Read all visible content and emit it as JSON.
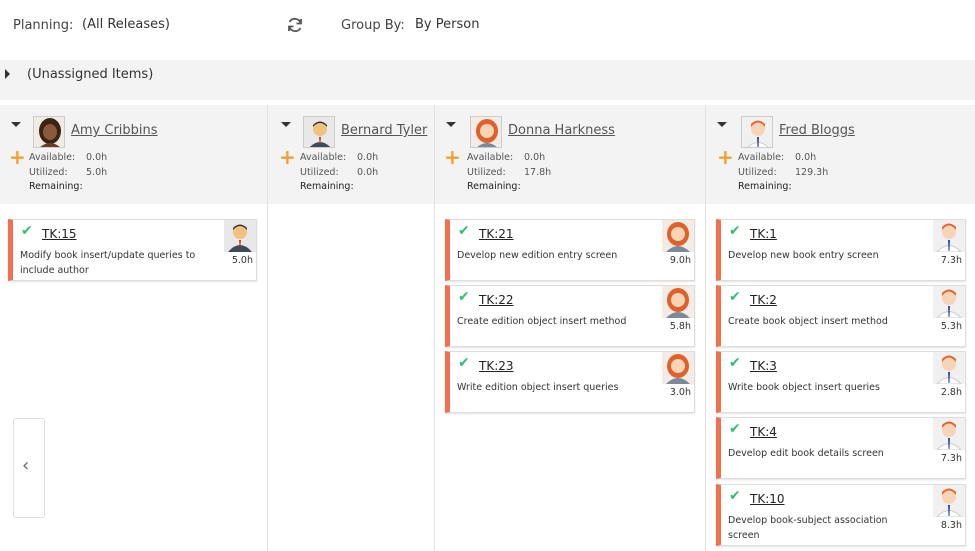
{
  "topbar": {
    "planning_label": "Planning:",
    "planning_value": "(All Releases)",
    "refresh_icon": "refresh-icon",
    "groupby_label": "Group By:",
    "groupby_value": "By Person"
  },
  "unassigned": {
    "label": "(Unassigned Items)"
  },
  "labels": {
    "available": "Available:",
    "utilized": "Utilized:",
    "remaining": "Remaining:"
  },
  "columns": [
    {
      "name": "Amy Cribbins",
      "available": "0.0h",
      "utilized": "5.0h",
      "cards": [
        {
          "id": "TK:15",
          "desc1": "Modify book insert/update queries to",
          "desc2": "include author",
          "hours": "5.0h"
        }
      ]
    },
    {
      "name": "Bernard Tyler",
      "available": "0.0h",
      "utilized": "0.0h",
      "cards": []
    },
    {
      "name": "Donna Harkness",
      "available": "0.0h",
      "utilized": "17.8h",
      "cards": [
        {
          "id": "TK:21",
          "desc1": "Develop new edition entry screen",
          "desc2": "",
          "hours": "9.0h"
        },
        {
          "id": "TK:22",
          "desc1": "Create edition object insert method",
          "desc2": "",
          "hours": "5.8h"
        },
        {
          "id": "TK:23",
          "desc1": "Write edition object insert queries",
          "desc2": "",
          "hours": "3.0h"
        }
      ]
    },
    {
      "name": "Fred Bloggs",
      "available": "0.0h",
      "utilized": "129.3h",
      "cards": [
        {
          "id": "TK:1",
          "desc1": "Develop new book entry screen",
          "desc2": "",
          "hours": "7.3h"
        },
        {
          "id": "TK:2",
          "desc1": "Create book object insert method",
          "desc2": "",
          "hours": "5.3h"
        },
        {
          "id": "TK:3",
          "desc1": "Write book object insert queries",
          "desc2": "",
          "hours": "2.8h"
        },
        {
          "id": "TK:4",
          "desc1": "Develop edit book details screen",
          "desc2": "",
          "hours": "7.3h"
        },
        {
          "id": "TK:10",
          "desc1": "Develop book-subject association",
          "desc2": "screen",
          "hours": "8.3h"
        }
      ]
    }
  ],
  "colors": {
    "card_accent": "#f07050",
    "check": "#2fbf71",
    "plus": "#f0a030"
  }
}
